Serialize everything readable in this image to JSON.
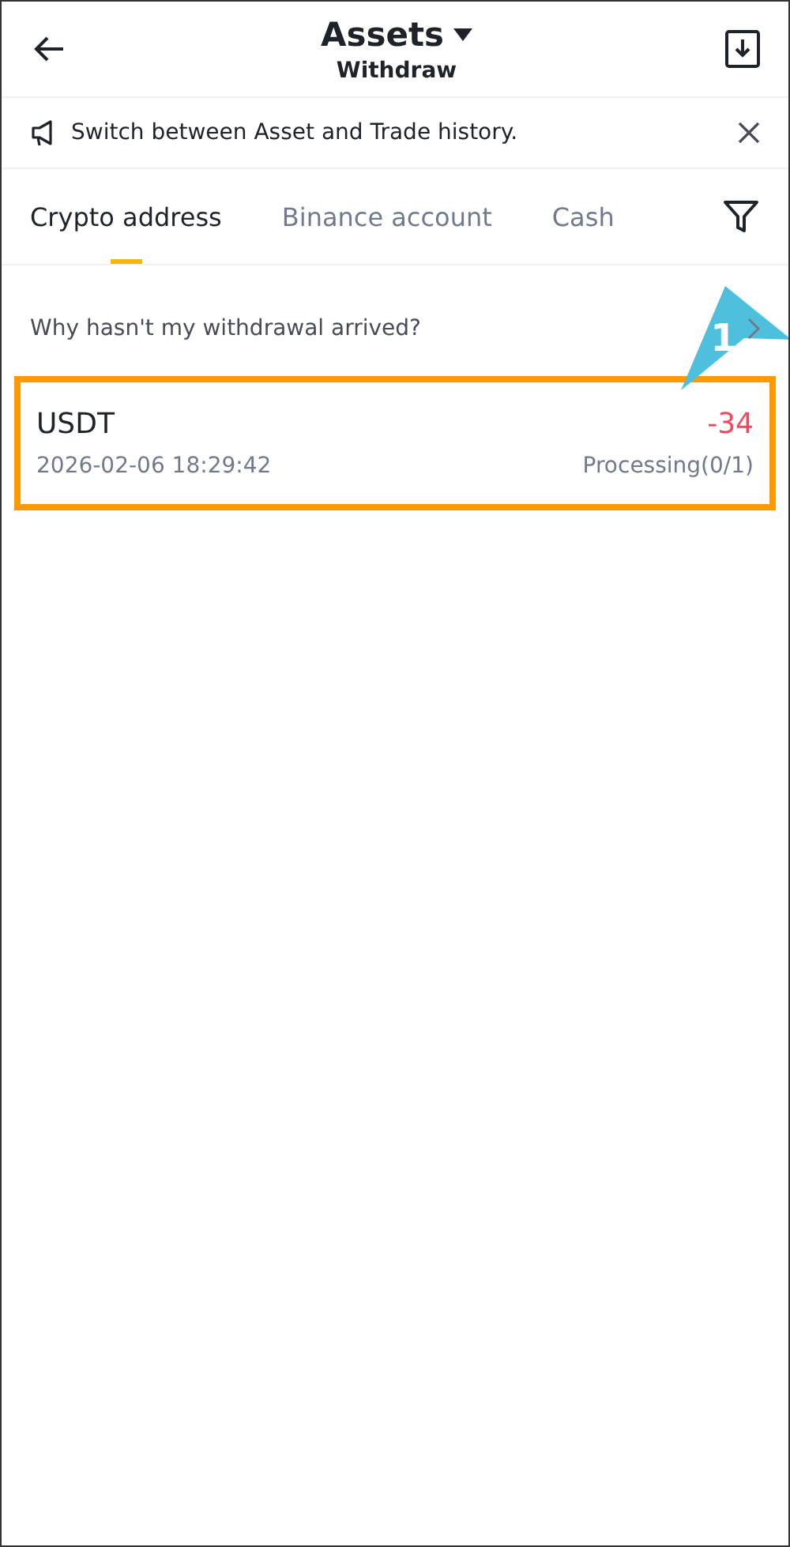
{
  "header": {
    "title": "Assets",
    "subtitle": "Withdraw"
  },
  "notice": {
    "text": "Switch between Asset and Trade history."
  },
  "tabs": [
    {
      "label": "Crypto address",
      "selected": true
    },
    {
      "label": "Binance account",
      "selected": false
    },
    {
      "label": "Cash",
      "selected": false
    }
  ],
  "help_link": "Why hasn't my withdrawal arrived?",
  "records": [
    {
      "coin": "USDT",
      "amount": "-34",
      "time": "2026-02-06 18:29:42",
      "status": "Processing(0/1)",
      "highlighted": true
    }
  ],
  "callout": {
    "label": "1"
  }
}
